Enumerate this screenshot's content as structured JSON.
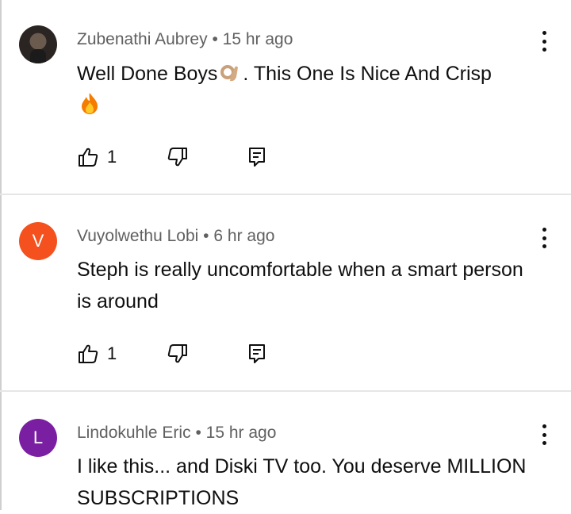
{
  "comments": [
    {
      "author": "Zubenathi Aubrey",
      "time": "15 hr ago",
      "text_part1": "Well Done Boys",
      "text_part2": ". This One Is Nice And Crisp",
      "emojis": [
        "ok-hand-emoji",
        "fire-emoji"
      ],
      "avatar_type": "photo",
      "likes": "1"
    },
    {
      "author": "Vuyolwethu Lobi",
      "time": "6 hr ago",
      "text": "Steph is really uncomfortable when a smart person is around",
      "avatar_letter": "V",
      "avatar_color": "#f4511e",
      "likes": "1"
    },
    {
      "author": "Lindokuhle Eric",
      "time": "15 hr ago",
      "text": "I like this... and Diski TV too. You deserve MILLION SUBSCRIPTIONS",
      "avatar_letter": "L",
      "avatar_color": "#7b1fa2"
    }
  ],
  "meta_separator": "•",
  "icons": [
    "thumb-up-icon",
    "thumb-down-icon",
    "reply-icon",
    "more-vert-icon"
  ]
}
